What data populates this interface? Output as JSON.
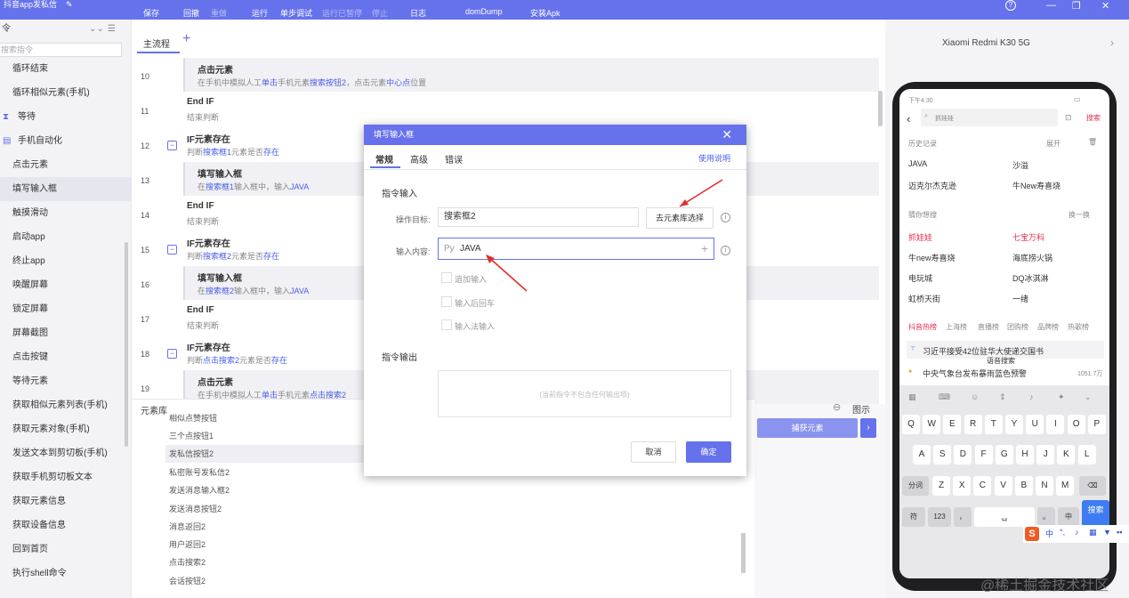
{
  "app": {
    "title": "抖音app发私信"
  },
  "toolbar": [
    {
      "label": "保存",
      "enabled": true
    },
    {
      "label": "回撤",
      "enabled": true
    },
    {
      "label": "重做",
      "enabled": false
    },
    {
      "label": "运行",
      "enabled": true
    },
    {
      "label": "单步调试",
      "enabled": true
    },
    {
      "label": "运行已暂停",
      "enabled": false
    },
    {
      "label": "停止",
      "enabled": false
    },
    {
      "label": "日志",
      "enabled": true
    },
    {
      "label": "domDump",
      "enabled": true
    },
    {
      "label": "安装Apk",
      "enabled": true
    }
  ],
  "window_controls": {
    "help": "?",
    "minimize": "—",
    "restore": "❐",
    "close": "✕"
  },
  "sidebar": {
    "header": "令",
    "search_placeholder": "搜索指令",
    "items": [
      {
        "label": "循环结束",
        "category": false
      },
      {
        "label": "循环相似元素(手机)",
        "category": false
      },
      {
        "label": "等待",
        "category": true,
        "icon": "hourglass-icon"
      },
      {
        "label": "手机自动化",
        "category": true,
        "icon": "phone-automation-icon"
      },
      {
        "label": "点击元素",
        "category": false
      },
      {
        "label": "填写输入框",
        "category": false,
        "active": true
      },
      {
        "label": "触摸滑动",
        "category": false
      },
      {
        "label": "启动app",
        "category": false
      },
      {
        "label": "终止app",
        "category": false
      },
      {
        "label": "唤醒屏幕",
        "category": false
      },
      {
        "label": "锁定屏幕",
        "category": false
      },
      {
        "label": "屏幕截图",
        "category": false
      },
      {
        "label": "点击按键",
        "category": false
      },
      {
        "label": "等待元素",
        "category": false
      },
      {
        "label": "获取相似元素列表(手机)",
        "category": false
      },
      {
        "label": "获取元素对象(手机)",
        "category": false
      },
      {
        "label": "发送文本到剪切板(手机)",
        "category": false
      },
      {
        "label": "获取手机剪切板文本",
        "category": false
      },
      {
        "label": "获取元素信息",
        "category": false
      },
      {
        "label": "获取设备信息",
        "category": false
      },
      {
        "label": "回到首页",
        "category": false
      },
      {
        "label": "执行shell命令",
        "category": false
      }
    ]
  },
  "flow": {
    "tab": "主流程",
    "rows": [
      {
        "num": "10",
        "title": "点击元素",
        "desc_parts": [
          "在手机中模拟人工",
          "单击",
          "手机元素",
          "搜索按钮2",
          "，点击元素",
          "中心点",
          "位置"
        ],
        "nested": true,
        "collapsible": false
      },
      {
        "num": "11",
        "title": "End IF",
        "desc_parts": [
          "结束判断"
        ],
        "nested": false,
        "collapsible": false
      },
      {
        "num": "12",
        "title": "IF元素存在",
        "desc_parts": [
          "判断",
          "搜索框1",
          "元素是否",
          "存在"
        ],
        "nested": false,
        "collapsible": true
      },
      {
        "num": "13",
        "title": "填写输入框",
        "desc_parts": [
          "在",
          "搜索框1",
          "输入框中，输入",
          "JAVA"
        ],
        "nested": true,
        "collapsible": false
      },
      {
        "num": "14",
        "title": "End IF",
        "desc_parts": [
          "结束判断"
        ],
        "nested": false,
        "collapsible": false
      },
      {
        "num": "15",
        "title": "IF元素存在",
        "desc_parts": [
          "判断",
          "搜索框2",
          "元素是否",
          "存在"
        ],
        "nested": false,
        "collapsible": true
      },
      {
        "num": "16",
        "title": "填写输入框",
        "desc_parts": [
          "在",
          "搜索框2",
          "输入框中，输入",
          "JAVA"
        ],
        "nested": true,
        "collapsible": false
      },
      {
        "num": "17",
        "title": "End IF",
        "desc_parts": [
          "结束判断"
        ],
        "nested": false,
        "collapsible": false
      },
      {
        "num": "18",
        "title": "IF元素存在",
        "desc_parts": [
          "判断",
          "点击搜索2",
          "元素是否",
          "存在"
        ],
        "nested": false,
        "collapsible": true
      },
      {
        "num": "19",
        "title": "点击元素",
        "desc_parts": [
          "在手机中模拟人工",
          "单击",
          "手机元素",
          "点击搜索2"
        ],
        "nested": true,
        "collapsible": false
      }
    ]
  },
  "element_library": {
    "header": "元素库",
    "show_image_label": "图示",
    "capture_button": "捕获元素",
    "items": [
      "相似点赞按钮",
      "三个点按钮1",
      "发私信按钮2",
      "私密账号发私信2",
      "发送消息输入框2",
      "发送消息按钮2",
      "消息返回2",
      "用户返回2",
      "点击搜索2",
      "会话按钮2"
    ],
    "selected_index": 2
  },
  "device": {
    "name": "Xiaomi Redmi K30 5G",
    "status_time": "下午4:30",
    "search_value": "抓娃娃",
    "search_button": "搜索",
    "history_label": "历史记录",
    "expand_label": "展开",
    "history": [
      "JAVA",
      "沙溢",
      "迈克尔杰克逊",
      "牛New寿喜烧"
    ],
    "guess_label": "猜你想搜",
    "refresh_label": "换一换",
    "guess": [
      "抓娃娃",
      "七宝万科",
      "牛new寿喜烧",
      "海底捞火锅",
      "电玩城",
      "DQ冰淇淋",
      "虹桥天街",
      "一绪"
    ],
    "hot_tabs": [
      "抖音热榜",
      "上海榜",
      "直播榜",
      "团购榜",
      "品牌榜",
      "热歌榜"
    ],
    "hot_items": [
      "习近平接受42位驻华大使递交国书",
      "中央气象台发布暴雨蓝色预警"
    ],
    "hot_count": "1051.7万",
    "voice_label": "语音搜索",
    "keys_row1": [
      "Q",
      "W",
      "E",
      "R",
      "T",
      "Y",
      "U",
      "I",
      "O",
      "P"
    ],
    "keys_row2": [
      "A",
      "S",
      "D",
      "F",
      "G",
      "H",
      "J",
      "K",
      "L"
    ],
    "keys_row3": [
      "Z",
      "X",
      "C",
      "V",
      "B",
      "N",
      "M"
    ],
    "key_split": "分词",
    "key_symbol": "符",
    "key_123": "123",
    "key_comma": "，",
    "key_period": "。",
    "key_zh": "中",
    "key_search": "搜索",
    "ime_logo": "S",
    "ime_zh": "中"
  },
  "dialog": {
    "title": "填写输入框",
    "tabs": [
      "常规",
      "高级",
      "错误"
    ],
    "help_link": "使用说明",
    "section_input": "指令输入",
    "target_label": "操作目标:",
    "target_value": "搜索框2",
    "pick_button": "去元素库选择",
    "content_label": "输入内容:",
    "content_prefix": "Py",
    "content_value": "JAVA",
    "checkboxes": [
      "追加输入",
      "输入后回车",
      "输入法输入"
    ],
    "section_output": "指令输出",
    "output_empty": "(当前指令不包含任何输出项)",
    "cancel": "取消",
    "ok": "确定"
  },
  "watermark": "@稀土掘金技术社区",
  "colors": {
    "accent": "#6672ec",
    "link": "#4a5de8",
    "arrow": "#e0302a",
    "hot": "#e0304e"
  }
}
